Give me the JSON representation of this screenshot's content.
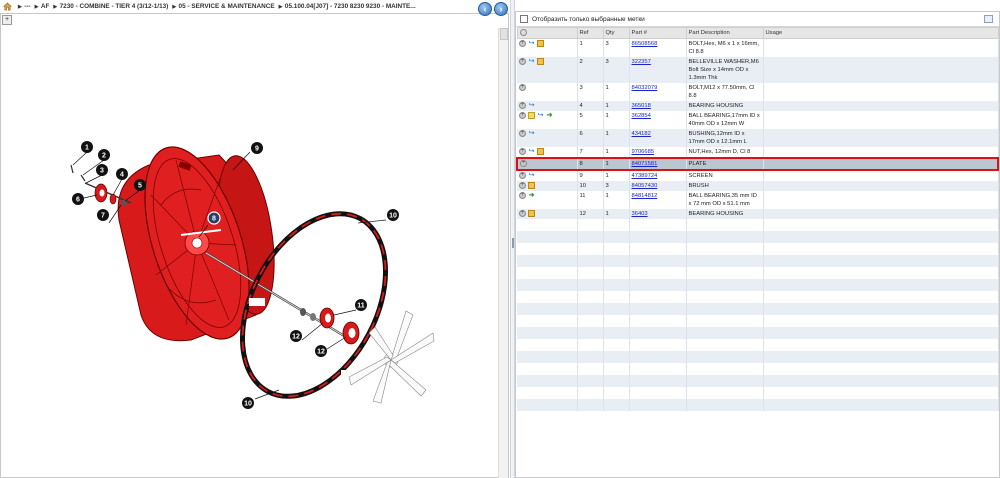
{
  "breadcrumb": [
    {
      "label": "---"
    },
    {
      "label": "AF"
    },
    {
      "label": "7230 - COMBINE - TIER 4 (3/12-1/13)"
    },
    {
      "label": "05 - SERVICE & MAINTENANCE"
    },
    {
      "label": "05.100.04[J07] - 7230 8230 9230 - MAINTE..."
    }
  ],
  "diagram": {
    "callouts": [
      "1",
      "2",
      "3",
      "4",
      "5",
      "6",
      "7",
      "8",
      "9",
      "10",
      "10",
      "11",
      "12",
      "12"
    ]
  },
  "filter": {
    "label": "Отобразить только выбранные метки"
  },
  "table": {
    "headers": {
      "ref": "Ref",
      "qty": "Qty",
      "part": "Part #",
      "desc": "Part Description",
      "usage": "Usage"
    },
    "rows": [
      {
        "ref": "1",
        "qty": "3",
        "part": "86508568",
        "desc": "BOLT,Hex, M6 x 1 x 16mm, Cl 8.8",
        "icons": [
          "add",
          "arrow",
          "box"
        ],
        "selected": false
      },
      {
        "ref": "2",
        "qty": "3",
        "part": "322357",
        "desc": "BELLEVILLE WASHER,M6 Bolt Size x 14mm OD x 1.3mm Thk",
        "icons": [
          "add",
          "arrow",
          "box"
        ],
        "selected": false
      },
      {
        "ref": "3",
        "qty": "1",
        "part": "84032079",
        "desc": "BOLT,M12 x 77.50mm, Cl 8.8",
        "icons": [
          "add"
        ],
        "selected": false
      },
      {
        "ref": "4",
        "qty": "1",
        "part": "365018",
        "desc": "BEARING HOUSING",
        "icons": [
          "add",
          "arrow"
        ],
        "selected": false
      },
      {
        "ref": "5",
        "qty": "1",
        "part": "362854",
        "desc": "BALL BEARING,17mm ID x 40mm OD x 12mm W",
        "icons": [
          "add",
          "note",
          "arrow",
          "green"
        ],
        "selected": false
      },
      {
        "ref": "6",
        "qty": "1",
        "part": "434182",
        "desc": "BUSHING,12mm ID x 17mm OD x 12.1mm L",
        "icons": [
          "add",
          "arrow"
        ],
        "selected": false
      },
      {
        "ref": "7",
        "qty": "1",
        "part": "9706685",
        "desc": "NUT,Hex, 12mm D, Cl 8",
        "icons": [
          "add",
          "arrow",
          "box"
        ],
        "selected": false
      },
      {
        "ref": "8",
        "qty": "1",
        "part": "84071581",
        "desc": "PLATE",
        "icons": [
          "add"
        ],
        "selected": true
      },
      {
        "ref": "9",
        "qty": "1",
        "part": "47389724",
        "desc": "SCREEN",
        "icons": [
          "add",
          "arrow"
        ],
        "selected": false
      },
      {
        "ref": "10",
        "qty": "3",
        "part": "84057430",
        "desc": "BRUSH",
        "icons": [
          "add",
          "box"
        ],
        "selected": false
      },
      {
        "ref": "11",
        "qty": "1",
        "part": "84814812",
        "desc": "BALL BEARING,35 mm ID x 72 mm OD x 51.1 mm",
        "icons": [
          "add",
          "green"
        ],
        "selected": false
      },
      {
        "ref": "12",
        "qty": "1",
        "part": "36403",
        "desc": "BEARING HOUSING",
        "icons": [
          "add",
          "box"
        ],
        "selected": false
      }
    ]
  },
  "colors": {
    "selection_border": "#dd1111",
    "link": "#1a24c8",
    "screen_red": "#d91a1a"
  }
}
